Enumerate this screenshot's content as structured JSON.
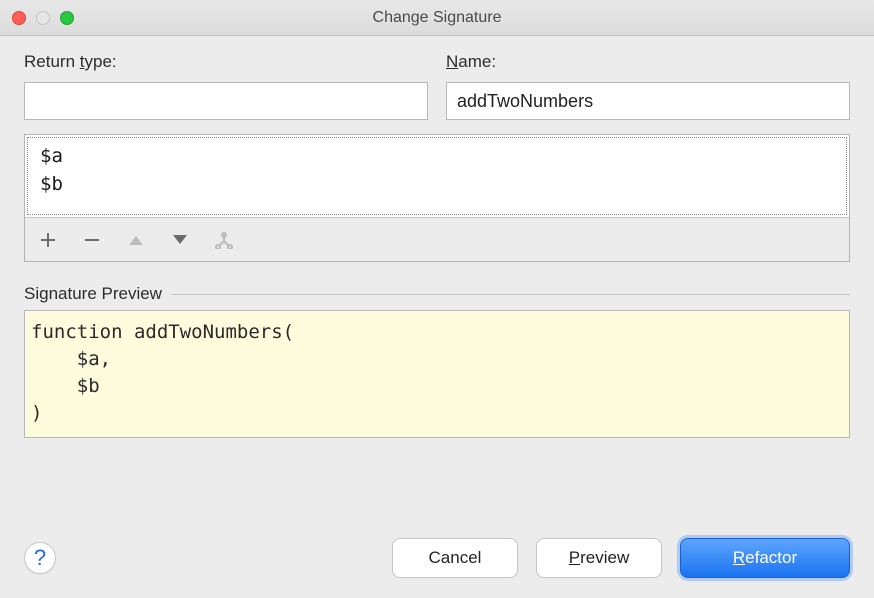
{
  "window": {
    "title": "Change Signature"
  },
  "fields": {
    "return_type": {
      "label_pre": "Return ",
      "label_mn": "t",
      "label_post": "ype:",
      "value": ""
    },
    "name": {
      "label_pre": "",
      "label_mn": "N",
      "label_post": "ame:",
      "value": "addTwoNumbers"
    }
  },
  "parameters": {
    "items": [
      "$a",
      "$b"
    ]
  },
  "toolbar": {
    "add": "add-icon",
    "remove": "remove-icon",
    "up": "up-icon",
    "down": "down-icon",
    "propagate": "propagate-icon"
  },
  "signature_preview": {
    "label": "Signature Preview",
    "text": "function addTwoNumbers(\n    $a,\n    $b\n)"
  },
  "buttons": {
    "help": "?",
    "cancel": "Cancel",
    "preview_pre": "",
    "preview_mn": "P",
    "preview_post": "review",
    "refactor_pre": "",
    "refactor_mn": "R",
    "refactor_post": "efactor"
  }
}
